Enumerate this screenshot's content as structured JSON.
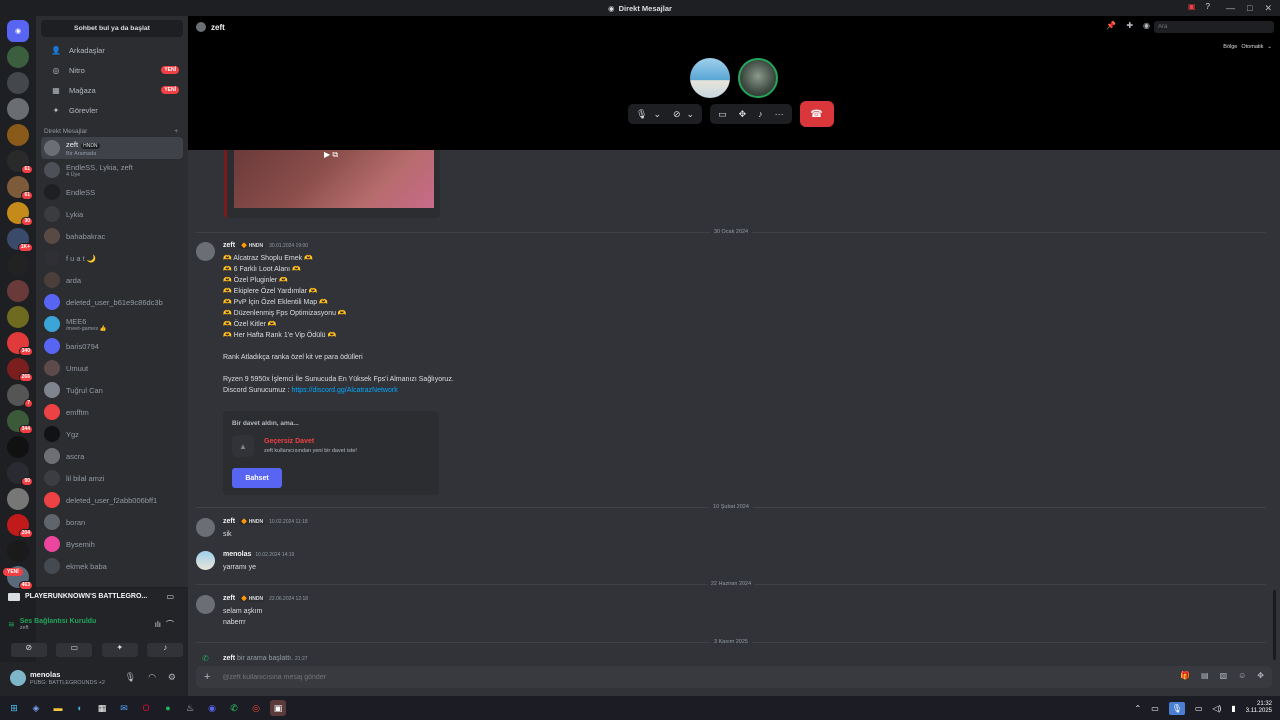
{
  "window": {
    "title": "Direkt Mesajlar"
  },
  "sidebar": {
    "search_label": "Sohbet bul ya da başlat",
    "nav": [
      {
        "label": "Arkadaşlar",
        "icon": "friends-icon"
      },
      {
        "label": "Nitro",
        "icon": "nitro-icon",
        "badge": "YENİ"
      },
      {
        "label": "Mağaza",
        "icon": "shop-icon",
        "badge": "YENİ"
      },
      {
        "label": "Görevler",
        "icon": "quests-icon"
      }
    ],
    "dm_header": "Direkt Mesajlar",
    "dms": [
      {
        "name": "zeft",
        "tag": "HNDN",
        "sub": "Bir Aramada",
        "color": "#6b6f75"
      },
      {
        "name": "EndleSS, Lykia, zeft",
        "sub": "4 Üye",
        "color": "#4e5058"
      },
      {
        "name": "EndleSS",
        "color": "#1e1f22"
      },
      {
        "name": "Lykia",
        "color": "#3a3c40"
      },
      {
        "name": "bahabakrac",
        "color": "#5a4a44"
      },
      {
        "name": "f u a t 🌙",
        "color": "#2f2f35"
      },
      {
        "name": "arda",
        "color": "#4a3f3a"
      },
      {
        "name": "deleted_user_b61e9c86dc3b",
        "color": "#5865f2"
      },
      {
        "name": "MEE6",
        "sub": "/meet-games 👍",
        "color": "#3ba5d8"
      },
      {
        "name": "baris0794",
        "color": "#5865f2"
      },
      {
        "name": "Umuut",
        "color": "#5d4a4a"
      },
      {
        "name": "Tuğrul Can",
        "color": "#80848e"
      },
      {
        "name": "emfftm",
        "color": "#ed4245"
      },
      {
        "name": "Ygz",
        "color": "#111214"
      },
      {
        "name": "ascra",
        "color": "#6d6f75"
      },
      {
        "name": "lil bilal amzi",
        "color": "#3b3d42"
      },
      {
        "name": "deleted_user_f2abb006bff1",
        "color": "#ed4245"
      },
      {
        "name": "boran",
        "color": "#60646b"
      },
      {
        "name": "Bysemih",
        "color": "#eb459e"
      },
      {
        "name": "ekmek baba",
        "color": "#454950"
      }
    ]
  },
  "servers": [
    {
      "color": "#5865f2",
      "glyph": "◉"
    },
    {
      "color": "#3b5e3f",
      "badge": ""
    },
    {
      "color": "#44474c"
    },
    {
      "color": "#6a6d72"
    },
    {
      "color": "#8a5a1a"
    },
    {
      "color": "#2a2a2a",
      "badge": "61"
    },
    {
      "color": "#7d5a3a",
      "badge": "61"
    },
    {
      "color": "#c48a1a",
      "badge": "30"
    },
    {
      "color": "#3a4a6a",
      "badge": "1K+"
    },
    {
      "color": "#222"
    },
    {
      "color": "#6a3a3a"
    },
    {
      "color": "#6e6a20"
    },
    {
      "color": "#e03a3a",
      "badge": "340"
    },
    {
      "color": "#7a1e1e",
      "badge": "266"
    },
    {
      "color": "#555",
      "badge": "7"
    },
    {
      "color": "#3a5a3a",
      "badge": "344"
    },
    {
      "color": "#111"
    },
    {
      "color": "#2a2a33",
      "badge": "90"
    },
    {
      "color": "#777"
    },
    {
      "color": "#c01a1a",
      "badge": "204"
    },
    {
      "color": "#1a1a1a"
    },
    {
      "color": "#5a6a7a",
      "badge": "463"
    }
  ],
  "servers_new": "YENİ",
  "voice": {
    "game": "PLAYERUNKNOWN'S BATTLEGRO...",
    "status": "Ses Bağlantısı Kuruldu",
    "channel": "zeft"
  },
  "user": {
    "name": "menolas",
    "status": "PUBG: BATTLEGROUNDS +2"
  },
  "topbar": {
    "channel": "zeft",
    "search_placeholder": "Ara",
    "region_label": "Bölge",
    "region_value": "Otomatik"
  },
  "messages": {
    "date1": "30 Ocak 2024",
    "m1": {
      "author": "zeft",
      "tag": "HNDN",
      "time": "30.01.2024 19:00",
      "lines": [
        "🫶 Alcatraz Shoplu Emek 🫶",
        "🫶 6 Farklı Loot Alanı 🫶",
        "🫶 Özel Pluginler 🫶",
        "🫶 Ekiplere Özel Yardımlar 🫶",
        "🫶 PvP İçin Özel Eklentili Map 🫶",
        "🫶 Düzenlenmiş Fps Optimizasyonu 🫶",
        "🫶 Özel Kitler 🫶",
        "🫶 Her Hafta Rank 1'e Vip Ödülü 🫶"
      ],
      "line_rank": "Rank Atladıkça ranka özel kit ve para ödülleri",
      "line_ryzen": "Ryzen 9 5950x İşlemci İle Sunucuda En Yüksek Fps'i Almanızı Sağlıyoruz.",
      "line_discord_label": "Discord Sunucumuz : ",
      "line_discord_link": "https://discord.gg/AlcatrazNetwork"
    },
    "invite": {
      "header": "Bir davet aldın, ama...",
      "title": "Geçersiz Davet",
      "desc": "zeft kullanıcısından yeni bir davet iste!",
      "button": "Bahset"
    },
    "date2": "10 Şubat 2024",
    "m2": {
      "author": "zeft",
      "tag": "HNDN",
      "time": "10.02.2024 11:18",
      "text": "sik"
    },
    "m3": {
      "author": "menolas",
      "time": "10.02.2024 14:19",
      "text": "yarramı ye"
    },
    "date3": "22 Haziran 2024",
    "m4": {
      "author": "zeft",
      "tag": "HNDN",
      "time": "22.06.2024 12:18",
      "text1": "selam aşkım",
      "text2": "naberrr"
    },
    "date4": "3 Kasım 2025",
    "call": {
      "author": "zeft",
      "text": "bir arama başlattı.",
      "time": "21:27"
    }
  },
  "input": {
    "placeholder": "@zeft kullanıcısına mesaj gönder"
  },
  "taskbar": {
    "time": "21:32",
    "date": "3.11.2025"
  }
}
